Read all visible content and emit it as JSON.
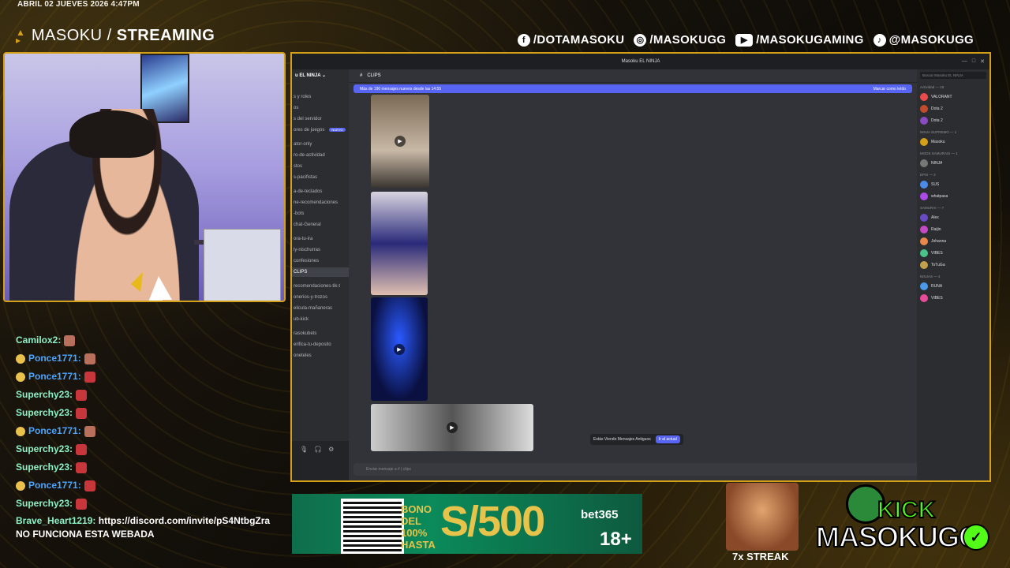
{
  "overlay": {
    "datetime": "ABRIL 02 JUEVES 2026 4:47PM",
    "brand_left": "MASOKU /",
    "brand_right": "STREAMING",
    "socials": [
      {
        "icon": "facebook-icon",
        "label": "/DOTAMASOKU"
      },
      {
        "icon": "instagram-icon",
        "label": "/MASOKUGG"
      },
      {
        "icon": "youtube-icon",
        "label": "/MASOKUGAMING"
      },
      {
        "icon": "tiktok-icon",
        "label": "@MASOKUGG"
      }
    ],
    "streak": "7x STREAK",
    "kick_label": "KICK",
    "kick_name": "MASOKUGG"
  },
  "chat": {
    "messages": [
      {
        "user": "Camilox2:",
        "color": "green",
        "badge": false,
        "emote": "alt"
      },
      {
        "user": "Ponce1771:",
        "color": "blue",
        "badge": true,
        "emote": "alt"
      },
      {
        "user": "Ponce1771:",
        "color": "blue",
        "badge": true,
        "emote": "red"
      },
      {
        "user": "Superchy23:",
        "color": "green",
        "badge": false,
        "emote": "red"
      },
      {
        "user": "Superchy23:",
        "color": "green",
        "badge": false,
        "emote": "red"
      },
      {
        "user": "Ponce1771:",
        "color": "blue",
        "badge": true,
        "emote": "alt"
      },
      {
        "user": "Superchy23:",
        "color": "green",
        "badge": false,
        "emote": "red"
      },
      {
        "user": "Superchy23:",
        "color": "green",
        "badge": false,
        "emote": "red"
      },
      {
        "user": "Ponce1771:",
        "color": "blue",
        "badge": true,
        "emote": "red"
      },
      {
        "user": "Superchy23:",
        "color": "green",
        "badge": false,
        "emote": "red"
      }
    ],
    "last_user": "Brave_Heart1219:",
    "last_text": "https://discord.com/invite/pS4NtbgZra NO FUNCIONA ESTA WEBADA"
  },
  "discord": {
    "window_title": "Masoku EL NINJA",
    "server_name": "u EL NINJA",
    "channel_name": "CLIPS",
    "banner_text": "Más de 190 mensajes nuevos desde las 14:55",
    "banner_action": "Marcar como leído",
    "channels": [
      {
        "name": "s y roles",
        "cls": "ch"
      },
      {
        "name": "os",
        "cls": "ch"
      },
      {
        "name": "s del servidor",
        "cls": "ch"
      },
      {
        "name": "ores de juegos",
        "cls": "ch",
        "tag": "NUEVO"
      },
      {
        "name": "ator-only",
        "cls": "ch"
      },
      {
        "name": "ro-de-actividad",
        "cls": "ch"
      },
      {
        "name": "stos",
        "cls": "ch"
      },
      {
        "name": "s-pacifistas",
        "cls": "ch"
      },
      {
        "name": "a-de-teclados",
        "cls": "ch"
      },
      {
        "name": "ne-recomendaciones",
        "cls": "ch"
      },
      {
        "name": "-bots",
        "cls": "ch"
      },
      {
        "name": "chat-General",
        "cls": "ch"
      },
      {
        "name": "ora-tu-ira",
        "cls": "ch"
      },
      {
        "name": "ly-nischurras",
        "cls": "ch"
      },
      {
        "name": "confesiones",
        "cls": "ch"
      },
      {
        "name": "CLIPS",
        "cls": "ch active"
      },
      {
        "name": "recomendaciones-tik-t",
        "cls": "ch"
      },
      {
        "name": "onerios-y-trozos",
        "cls": "ch"
      },
      {
        "name": "elicula-mañaneras",
        "cls": "ch"
      },
      {
        "name": "ub-kick",
        "cls": "ch"
      },
      {
        "name": "rasokubets",
        "cls": "ch"
      },
      {
        "name": "erifica-tu-deposito",
        "cls": "ch"
      },
      {
        "name": "oneteles",
        "cls": "ch"
      }
    ],
    "old_messages_text": "Estás Viendo Mensajes Antiguos",
    "jump_button": "Ir al actual",
    "input_placeholder": "Enviar mensaje a # | clips",
    "members_search": "Buscar Masoku EL NINJA",
    "members": [
      {
        "section": "Actividad — 15"
      },
      {
        "name": "VALORANT",
        "color": "#e94a4a"
      },
      {
        "name": "Dota 2",
        "color": "#c34a2a"
      },
      {
        "name": "Dota 2",
        "color": "#8a4ac3"
      },
      {
        "section": "NINJA SUPREMO — 1"
      },
      {
        "name": "Masoku",
        "color": "#d4a017"
      },
      {
        "section": "MODS SAMURAIS — 1"
      },
      {
        "name": "NINJA",
        "color": "#777"
      },
      {
        "section": "EPIS — 2"
      },
      {
        "name": "SUS",
        "color": "#4a8ae9"
      },
      {
        "name": "whatpasa",
        "color": "#aa4ae9"
      },
      {
        "section": "SAMURAI — 7"
      },
      {
        "name": "Alex",
        "color": "#6a4ac3"
      },
      {
        "name": "Raijin",
        "color": "#c34ac3"
      },
      {
        "name": "Johanna",
        "color": "#e9884a"
      },
      {
        "name": "VIBES",
        "color": "#4ac38a"
      },
      {
        "name": "ToTuGa",
        "color": "#c3a04a"
      },
      {
        "section": "NINJAS — 4"
      },
      {
        "name": "RUNA",
        "color": "#4a9ae9"
      },
      {
        "name": "VIBES",
        "color": "#e94a9a"
      }
    ]
  },
  "ad": {
    "bono": "BONO DEL 100% HASTA",
    "amount": "S/500",
    "brand": "bet365",
    "age": "18+"
  }
}
